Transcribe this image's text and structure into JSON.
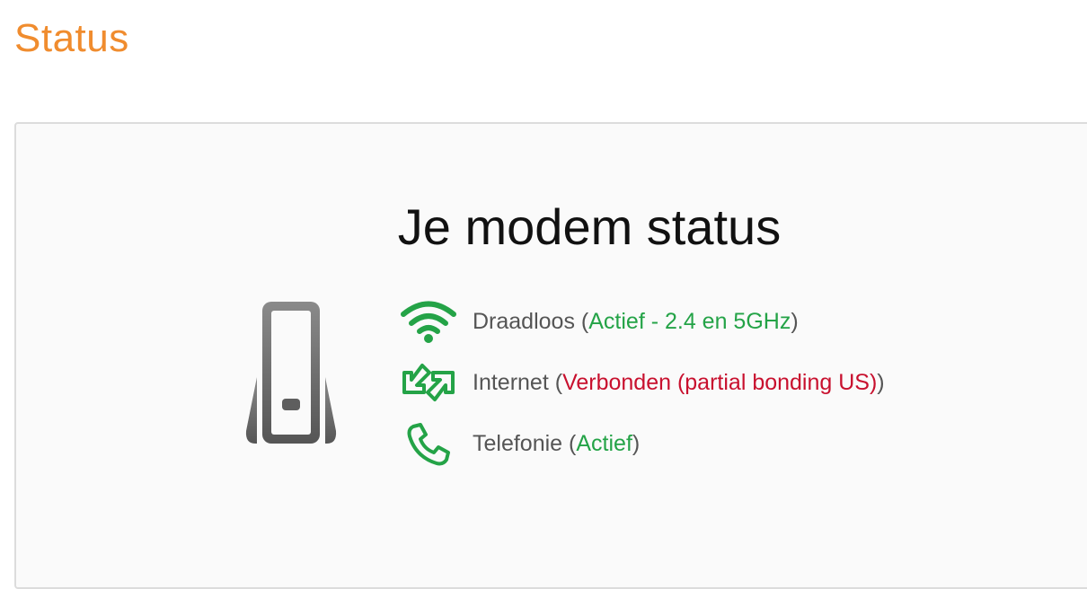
{
  "page": {
    "title": "Status",
    "accent_color": "#f08c2e"
  },
  "modem_panel": {
    "heading": "Je modem status",
    "device_icon": "modem-icon",
    "items": [
      {
        "icon": "wifi-icon",
        "label": "Draadloos",
        "open_paren": " (",
        "state": "Actief - 2.4 en 5GHz",
        "close_paren": ")",
        "state_color": "#24a347"
      },
      {
        "icon": "internet-arrows-icon",
        "label": "Internet",
        "open_paren": " (",
        "state": "Verbonden (partial bonding US)",
        "close_paren": ")",
        "state_color": "#c8102e"
      },
      {
        "icon": "phone-icon",
        "label": "Telefonie",
        "open_paren": " (",
        "state": "Actief",
        "close_paren": ")",
        "state_color": "#24a347"
      }
    ]
  }
}
